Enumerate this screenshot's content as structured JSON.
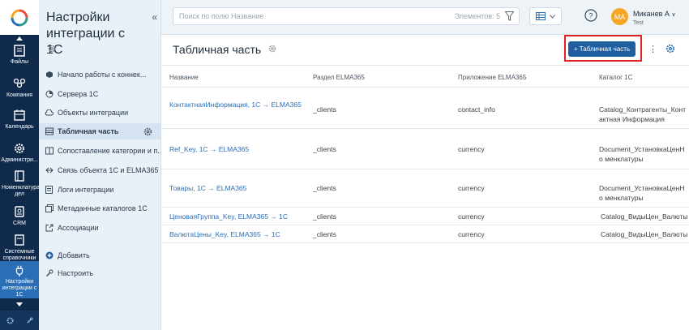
{
  "rail": {
    "items": [
      {
        "label": "Файлы",
        "icon": "files-icon"
      },
      {
        "label": "Компания",
        "icon": "company-icon"
      },
      {
        "label": "Календарь",
        "icon": "calendar-icon"
      },
      {
        "label": "Администри...",
        "icon": "gear-icon"
      },
      {
        "label": "Номенклатура дел",
        "icon": "book-icon"
      },
      {
        "label": "CRM",
        "icon": "crm-icon"
      },
      {
        "label": "Системные справочники",
        "icon": "directory-icon"
      },
      {
        "label": "Настройки интеграции с 1С",
        "icon": "plug-icon"
      }
    ]
  },
  "sidebar": {
    "title": "Настройки интеграции с 1С",
    "items": [
      {
        "label": "Начало работы с коннек...",
        "icon": "box-icon"
      },
      {
        "label": "Сервера 1С",
        "icon": "server-icon"
      },
      {
        "label": "Объекты интеграции",
        "icon": "cloud-icon"
      },
      {
        "label": "Табличная часть",
        "icon": "table-icon"
      },
      {
        "label": "Сопоставление категории и п...",
        "icon": "compare-icon"
      },
      {
        "label": "Связь объекта 1С и ELMA365",
        "icon": "link-icon"
      },
      {
        "label": "Логи интеграции",
        "icon": "doc-icon"
      },
      {
        "label": "Метаданные каталогов 1С",
        "icon": "layers-icon"
      },
      {
        "label": "Ассоциации",
        "icon": "external-icon"
      }
    ],
    "add_label": "Добавить",
    "configure_label": "Настроить"
  },
  "topbar": {
    "search_placeholder": "Поиск по полю Название",
    "count_label": "Элементов: 5",
    "user_initials": "МА",
    "user_name": "Миканев А",
    "user_sub": "Test"
  },
  "page": {
    "title": "Табличная часть",
    "add_button": "+ Табличная часть"
  },
  "table": {
    "headers": [
      "Название",
      "Раздел ELMA365",
      "Приложение ELMA365",
      "Каталог 1С"
    ],
    "rows": [
      {
        "name": "КонтактнаяИнформация, 1С → ELMA365",
        "section": "_clients",
        "app": "contact_info",
        "catalog": "Catalog_Контрагенты_Контактная Информация"
      },
      {
        "name": "Ref_Key, 1С → ELMA365",
        "section": "_clients",
        "app": "currency",
        "catalog": "Document_УстановкаЦенНо менклатуры"
      },
      {
        "name": "Товары, 1С → ELMA365",
        "section": "_clients",
        "app": "currency",
        "catalog": "Document_УстановкаЦенНо менклатуры"
      },
      {
        "name": "ЦеноваяГруппа_Key, ELMA365 → 1С",
        "section": "_clients",
        "app": "currency",
        "catalog": "Catalog_ВидыЦен_Валюты"
      },
      {
        "name": "ВалютаЦены_Key, ELMA365 → 1С",
        "section": "_clients",
        "app": "currency",
        "catalog": "Catalog_ВидыЦен_Валюты"
      }
    ]
  }
}
